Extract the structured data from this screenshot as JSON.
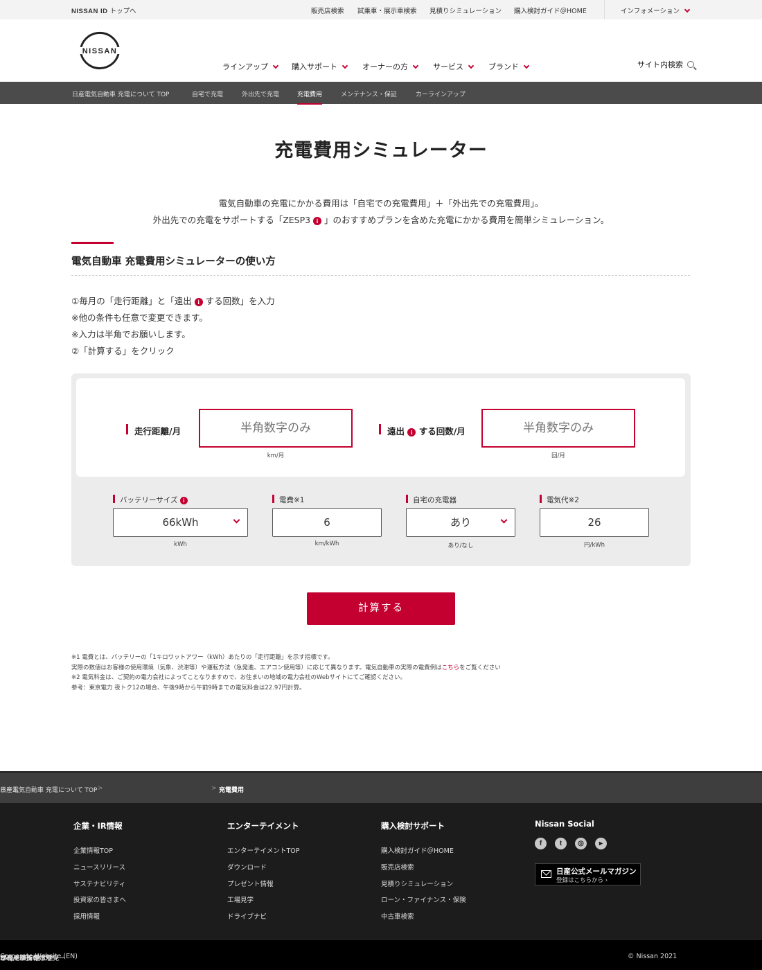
{
  "util": {
    "nissan_id": "NISSAN ID",
    "to_top": "トップへ",
    "links": [
      "販売店検索",
      "試乗車・展示車検索",
      "見積りシミュレーション",
      "購入検討ガイド＠HOME"
    ],
    "info": "インフォメーション"
  },
  "header": {
    "logo_text": "NISSAN",
    "nav": [
      "ラインアップ",
      "購入サポート",
      "オーナーの方",
      "サービス",
      "ブランド"
    ],
    "search": "サイト内検索"
  },
  "subnav": [
    "日産電気自動車 充電について TOP",
    "自宅で充電",
    "外出先で充電",
    "充電費用",
    "メンテナンス・保証",
    "カーラインアップ"
  ],
  "page": {
    "title": "充電費用シミュレーター",
    "lead1": "電気自動車の充電にかかる費用は「自宅での充電費用」＋「外出先での充電費用」。",
    "lead2_a": "外出先での充電をサポートする「ZESP3 ",
    "lead2_b": " 」のおすすめプランを含めた充電にかかる費用を簡単シミュレーション。",
    "section_title": "電気自動車  充電費用シミュレーターの使い方",
    "howto1_a": "①毎月の「走行距離」と「遠出 ",
    "howto1_b": " する回数」を入力",
    "howto2": "※他の条件も任意で変更できます。",
    "howto3": "※入力は半角でお願いします。",
    "howto4": "②「計算する」をクリック"
  },
  "simulator": {
    "distance_label": "走行距離/月",
    "distance_placeholder": "半角数字のみ",
    "distance_unit": "km/月",
    "trips_label_a": "遠出 ",
    "trips_label_b": " する回数/月",
    "trips_placeholder": "半角数字のみ",
    "trips_unit": "回/月",
    "battery_label": "バッテリーサイズ ",
    "battery_value": "66kWh",
    "battery_unit": "kWh",
    "efficiency_label": "電費※1",
    "efficiency_value": "6",
    "efficiency_unit": "km/kWh",
    "charger_label": "自宅の充電器",
    "charger_value": "あり",
    "charger_unit": "あり/なし",
    "price_label": "電気代※2",
    "price_value": "26",
    "price_unit": "円/kWh",
    "calculate": "計算する"
  },
  "notes": {
    "n1": "※1 電費とは、バッテリーの「1キロワットアワー（kWh）あたりの「走行距離」を示す指標です。",
    "n2_a": "実際の数値はお客様の使用環境（気象、渋滞等）や運転方法（急発進、エアコン使用等）に応じて異なります。電気自動車の実際の電費例は",
    "n2_link": "こちら",
    "n2_b": "をご覧ください",
    "n3": "※2 電気料金は、ご契約の電力会社によってことなりますので、お住まいの地域の電力会社のWebサイトにてご確認ください。",
    "n4": "参考：東京電力 夜トク12の場合、午後9時から午前9時までの電気料金は22.97円計算。"
  },
  "footer": {
    "breadcrumb": [
      "ホーム",
      "日産電気自動車 充電について TOP",
      "充電費用"
    ],
    "col1_title": "企業・IR情報",
    "col1": [
      "企業情報TOP",
      "ニュースリリース",
      "サステナビリティ",
      "投資家の皆さまへ",
      "採用情報"
    ],
    "col2_title": "エンターテイメント",
    "col2": [
      "エンターテイメントTOP",
      "ダウンロード",
      "プレゼント情報",
      "工場見学",
      "ドライブナビ"
    ],
    "col3_title": "購入検討サポート",
    "col3": [
      "購入検討ガイド＠HOME",
      "販売店検索",
      "見積りシミュレーション",
      "ローン・ファイナンス・保険",
      "中古車検索"
    ],
    "social_title": "Nissan Social",
    "mag_title": "日産公式メールマガジン",
    "mag_sub": "登録はこちらから",
    "bottom": [
      "サイトマップ",
      "プライバシーポリシー",
      "ご利用にあたって",
      "リコール情報",
      "FAQ/お問い合わせ",
      "Corporate Website (EN)",
      "本ページへのご意見",
      "© Nissan 2021"
    ]
  }
}
